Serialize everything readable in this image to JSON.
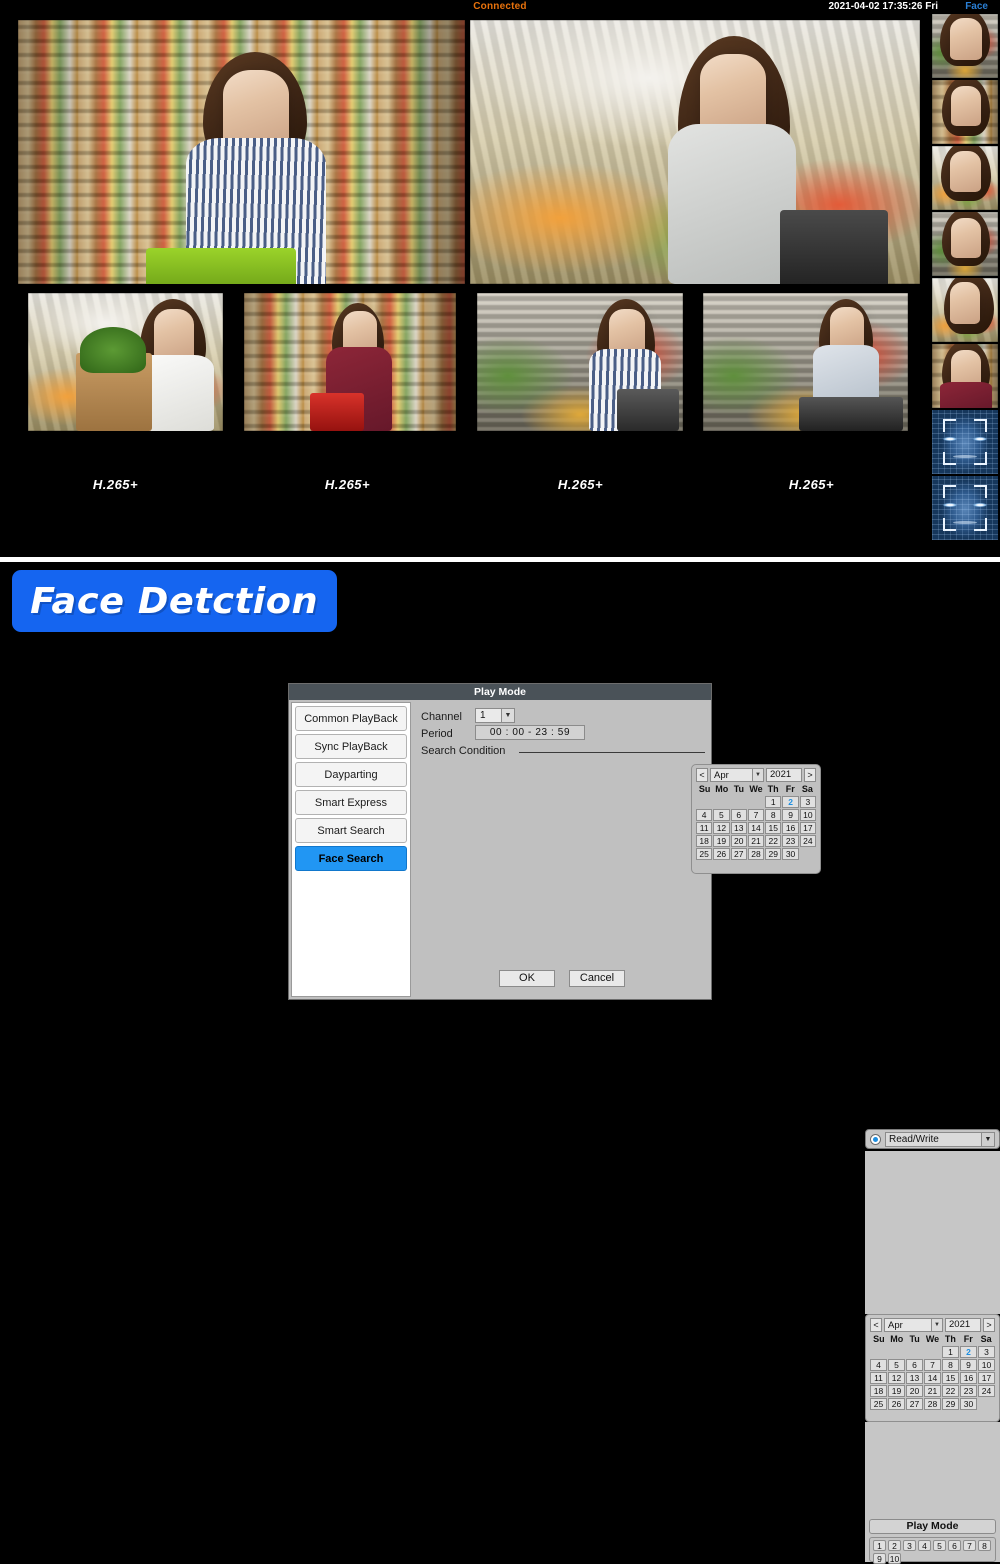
{
  "nvr": {
    "status": "Connected",
    "datetime": "2021-04-02 17:35:26 Fri",
    "face_label": "Face",
    "codec_labels": [
      "H.265+",
      "H.265+",
      "H.265+",
      "H.265+"
    ],
    "cameras": [
      {
        "name": "camera-1-shopper-aisle"
      },
      {
        "name": "camera-2-shopper-produce"
      },
      {
        "name": "camera-3-shopper-bag"
      },
      {
        "name": "camera-4-shopper-basket"
      },
      {
        "name": "camera-5-shopper-cart"
      },
      {
        "name": "camera-6-shopper-fruit"
      }
    ],
    "face_thumbnails": [
      {
        "name": "face-capture-1",
        "type": "photo"
      },
      {
        "name": "face-capture-2",
        "type": "photo"
      },
      {
        "name": "face-capture-3",
        "type": "photo"
      },
      {
        "name": "face-capture-4",
        "type": "photo"
      },
      {
        "name": "face-capture-5",
        "type": "photo"
      },
      {
        "name": "face-capture-6",
        "type": "photo"
      },
      {
        "name": "face-capture-7",
        "type": "mesh"
      },
      {
        "name": "face-capture-8",
        "type": "mesh"
      }
    ]
  },
  "banner": {
    "text": "Face Detction"
  },
  "dialog": {
    "title": "Play Mode",
    "modes": [
      {
        "label": "Common PlayBack",
        "active": false
      },
      {
        "label": "Sync PlayBack",
        "active": false
      },
      {
        "label": "Dayparting",
        "active": false
      },
      {
        "label": "Smart Express",
        "active": false
      },
      {
        "label": "Smart Search",
        "active": false
      },
      {
        "label": "Face Search",
        "active": true
      }
    ],
    "channel_label": "Channel",
    "channel_value": "1",
    "period_label": "Period",
    "period_value": "00 : 00   -   23 : 59",
    "search_condition_label": "Search Condition",
    "calendar": {
      "prev": "<",
      "next": ">",
      "month": "Apr",
      "year": "2021",
      "dow": [
        "Su",
        "Mo",
        "Tu",
        "We",
        "Th",
        "Fr",
        "Sa"
      ],
      "lead_blanks": 4,
      "days": [
        1,
        2,
        3,
        4,
        5,
        6,
        7,
        8,
        9,
        10,
        11,
        12,
        13,
        14,
        15,
        16,
        17,
        18,
        19,
        20,
        21,
        22,
        23,
        24,
        25,
        26,
        27,
        28,
        29,
        30
      ],
      "selected": 2
    },
    "ok_label": "OK",
    "cancel_label": "Cancel"
  },
  "right_panel": {
    "access_mode": "Read/Write",
    "calendar": {
      "prev": "<",
      "next": ">",
      "month": "Apr",
      "year": "2021",
      "dow": [
        "Su",
        "Mo",
        "Tu",
        "We",
        "Th",
        "Fr",
        "Sa"
      ],
      "lead_blanks": 4,
      "days": [
        1,
        2,
        3,
        4,
        5,
        6,
        7,
        8,
        9,
        10,
        11,
        12,
        13,
        14,
        15,
        16,
        17,
        18,
        19,
        20,
        21,
        22,
        23,
        24,
        25,
        26,
        27,
        28,
        29,
        30
      ],
      "selected": 2
    },
    "play_mode_label": "Play Mode",
    "channels_row1": [
      "1",
      "2",
      "3",
      "4",
      "5",
      "6",
      "7",
      "8"
    ],
    "channels_row2": [
      "9",
      "10"
    ]
  },
  "colors": {
    "accent_blue": "#1565f0",
    "status_orange": "#e8720c",
    "face_link_blue": "#2a7fd4",
    "selection_blue": "#2196f3",
    "dialog_gray": "#c0c0c0",
    "titlebar": "#4a5258"
  }
}
